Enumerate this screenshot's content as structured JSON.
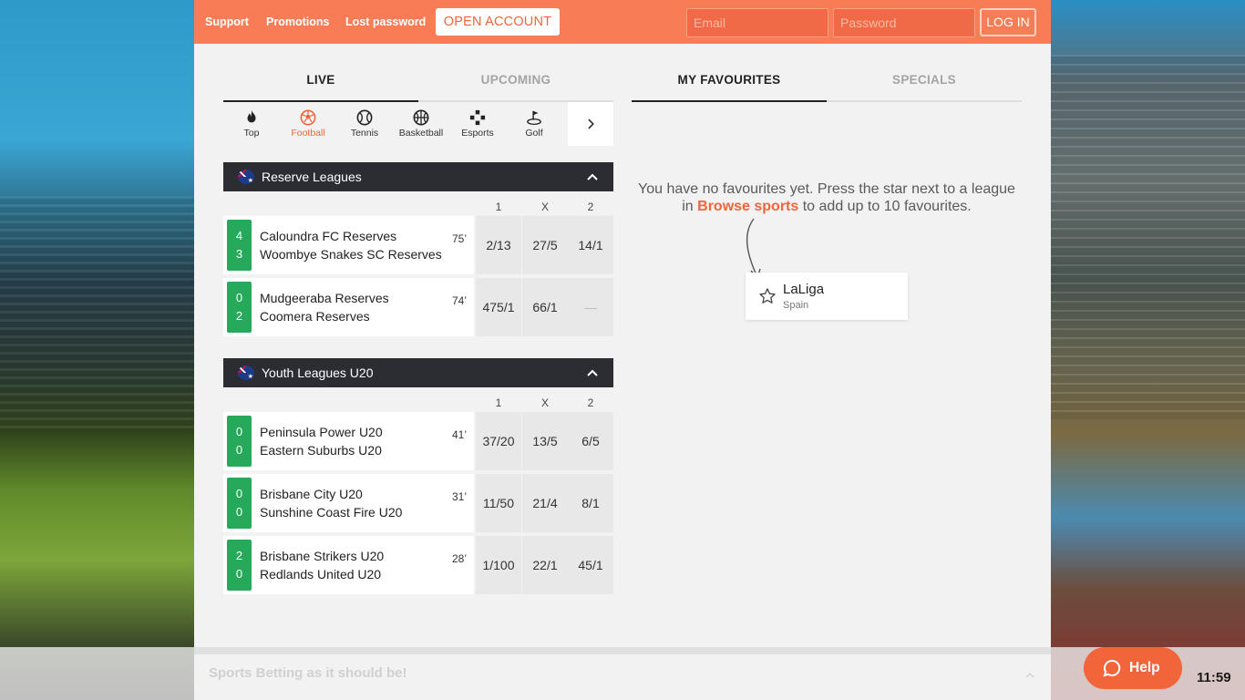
{
  "topbar": {
    "links": [
      "Support",
      "Promotions",
      "Lost password"
    ],
    "open_account": "OPEN ACCOUNT",
    "email_placeholder": "Email",
    "password_placeholder": "Password",
    "login": "LOG IN"
  },
  "tabs_left": [
    "LIVE",
    "UPCOMING"
  ],
  "tabs_right": [
    "MY FAVOURITES",
    "SPECIALS"
  ],
  "sports": [
    {
      "label": "Top",
      "icon": "flame-icon"
    },
    {
      "label": "Football",
      "icon": "football-icon"
    },
    {
      "label": "Tennis",
      "icon": "tennis-icon"
    },
    {
      "label": "Basketball",
      "icon": "basketball-icon"
    },
    {
      "label": "Esports",
      "icon": "gamepad-icon"
    },
    {
      "label": "Golf",
      "icon": "golf-icon"
    }
  ],
  "odds_headers": [
    "1",
    "X",
    "2"
  ],
  "leagues": [
    {
      "name": "Reserve Leagues",
      "matches": [
        {
          "home": "Caloundra FC Reserves",
          "away": "Woombye Snakes SC Reserves",
          "score_home": "4",
          "score_away": "3",
          "minute": "75’",
          "odds": [
            "2/13",
            "27/5",
            "14/1"
          ]
        },
        {
          "home": "Mudgeeraba Reserves",
          "away": "Coomera Reserves",
          "score_home": "0",
          "score_away": "2",
          "minute": "74’",
          "odds": [
            "475/1",
            "66/1",
            "—"
          ]
        }
      ]
    },
    {
      "name": "Youth Leagues U20",
      "matches": [
        {
          "home": "Peninsula Power U20",
          "away": "Eastern Suburbs U20",
          "score_home": "0",
          "score_away": "0",
          "minute": "41’",
          "odds": [
            "37/20",
            "13/5",
            "6/5"
          ]
        },
        {
          "home": "Brisbane City U20",
          "away": "Sunshine Coast Fire U20",
          "score_home": "0",
          "score_away": "0",
          "minute": "31’",
          "odds": [
            "11/50",
            "21/4",
            "8/1"
          ]
        },
        {
          "home": "Brisbane Strikers U20",
          "away": "Redlands United U20",
          "score_home": "2",
          "score_away": "0",
          "minute": "28’",
          "odds": [
            "1/100",
            "22/1",
            "45/1"
          ]
        }
      ]
    }
  ],
  "favourites": {
    "message_before": "You have no favourites yet. Press the star next to a league in",
    "link": "Browse sports",
    "message_after": "to add up to 10 favourites.",
    "example_title": "LaLiga",
    "example_sub": "Spain"
  },
  "footer": {
    "tagline": "Sports Betting as it should be!"
  },
  "help": {
    "label": "Help"
  },
  "clock": "11:59",
  "colors": {
    "accent": "#f87c56",
    "score_green": "#26a95b",
    "header_dark": "#2b2d33"
  }
}
